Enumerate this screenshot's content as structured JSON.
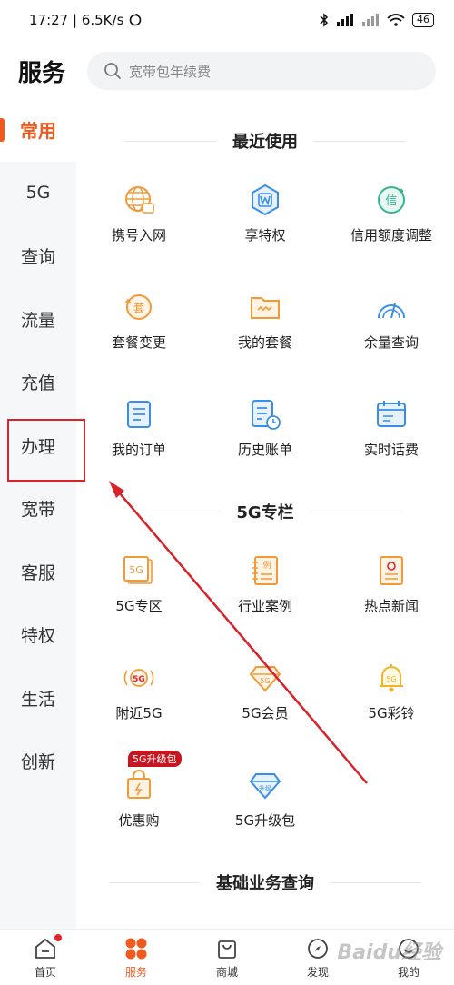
{
  "status": {
    "time_speed": "17:27 | 6.5K/s",
    "battery": "46"
  },
  "header": {
    "title": "服务",
    "search_placeholder": "宽带包年续费"
  },
  "sidebar": {
    "items": [
      {
        "label": "常用"
      },
      {
        "label": "5G"
      },
      {
        "label": "查询"
      },
      {
        "label": "流量"
      },
      {
        "label": "充值"
      },
      {
        "label": "办理"
      },
      {
        "label": "宽带"
      },
      {
        "label": "客服"
      },
      {
        "label": "特权"
      },
      {
        "label": "生活"
      },
      {
        "label": "创新"
      }
    ],
    "active": "常用"
  },
  "sections": {
    "recent": {
      "title": "最近使用",
      "items": [
        {
          "label": "携号入网",
          "icon": "globe-icon"
        },
        {
          "label": "享特权",
          "icon": "hexagon-w-icon"
        },
        {
          "label": "信用额度调整",
          "icon": "credit-icon"
        },
        {
          "label": "套餐变更",
          "icon": "package-change-icon"
        },
        {
          "label": "我的套餐",
          "icon": "folder-icon"
        },
        {
          "label": "余量查询",
          "icon": "gauge-icon"
        },
        {
          "label": "我的订单",
          "icon": "order-icon"
        },
        {
          "label": "历史账单",
          "icon": "bill-history-icon"
        },
        {
          "label": "实时话费",
          "icon": "calendar-bill-icon"
        }
      ]
    },
    "fiveg": {
      "title": "5G专栏",
      "items": [
        {
          "label": "5G专区",
          "icon": "5g-zone-icon"
        },
        {
          "label": "行业案例",
          "icon": "case-book-icon"
        },
        {
          "label": "热点新闻",
          "icon": "news-icon"
        },
        {
          "label": "附近5G",
          "icon": "nearby-5g-icon"
        },
        {
          "label": "5G会员",
          "icon": "5g-diamond-icon"
        },
        {
          "label": "5G彩铃",
          "icon": "bell-icon"
        },
        {
          "label": "优惠购",
          "icon": "shopping-bag-icon",
          "badge": "5G升级包"
        },
        {
          "label": "5G升级包",
          "icon": "upgrade-diamond-icon"
        }
      ]
    },
    "basic": {
      "title": "基础业务查询"
    }
  },
  "tabbar": {
    "items": [
      {
        "label": "首页"
      },
      {
        "label": "服务"
      },
      {
        "label": "商城"
      },
      {
        "label": "发现"
      },
      {
        "label": "我的"
      }
    ],
    "active": "服务"
  },
  "watermark": "Baidu经验",
  "colors": {
    "accent": "#f05a1e",
    "icon_blue": "#3a8ee6",
    "icon_orange": "#f29a3a",
    "annotation": "#d9232a"
  }
}
